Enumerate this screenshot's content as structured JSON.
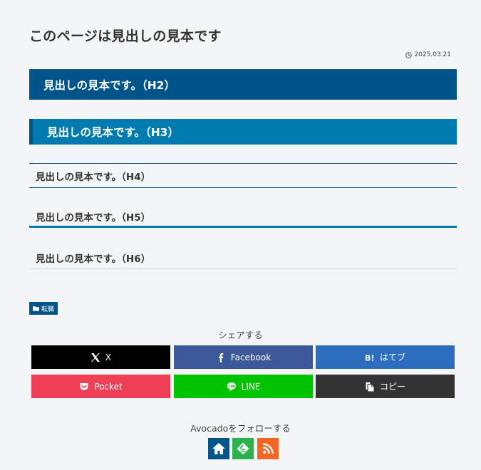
{
  "page": {
    "title": "このページは見出しの見本です",
    "date": "2025.03.21"
  },
  "headings": {
    "h2": "見出しの見本です。（H2）",
    "h3": "見出しの見本です。（H3）",
    "h4": "見出しの見本です。（H4）",
    "h5": "見出しの見本です。（H5）",
    "h6": "見出しの見本です。（H6）"
  },
  "category": {
    "label": "転職"
  },
  "share": {
    "label": "シェアする",
    "buttons": {
      "x": "X",
      "facebook": "Facebook",
      "hatena": "はてブ",
      "pocket": "Pocket",
      "line": "LINE",
      "copy": "コピー"
    }
  },
  "follow": {
    "label": "Avocadoをフォローする"
  },
  "colors": {
    "primary": "#00548a",
    "secondary": "#007bb0",
    "x": "#000000",
    "facebook": "#3b5998",
    "hatena": "#2c6ebd",
    "pocket": "#ef3f56",
    "line": "#00c300",
    "copy": "#333333",
    "feedly": "#2bb24c",
    "rss": "#f26522"
  }
}
